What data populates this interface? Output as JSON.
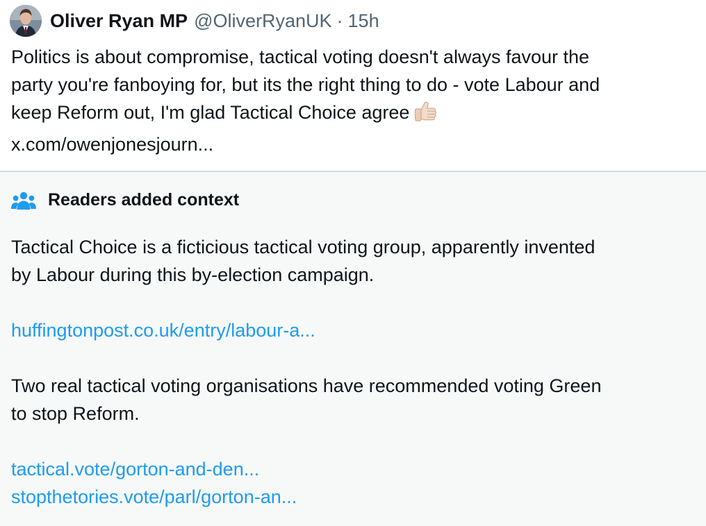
{
  "tweet": {
    "author_name": "Oliver Ryan MP",
    "author_handle": "@OliverRyanUK",
    "separator": "·",
    "timestamp": "15h",
    "body_lines": [
      "Politics is about compromise, tactical voting doesn't always favour the",
      "party you're fanboying for, but its the right thing to do - vote Labour and",
      "keep Reform out, I'm glad Tactical Choice agree",
      "x.com/owenjonesjourn..."
    ],
    "emoji_icon": "thumbs-up-icon"
  },
  "context": {
    "icon": "people-icon",
    "title": "Readers added context",
    "paragraph1_lines": [
      "Tactical Choice is a ficticious tactical voting group, apparently invented",
      "by Labour during this by-election campaign."
    ],
    "link1": "huffingtonpost.co.uk/entry/labour-a...",
    "paragraph2_lines": [
      "Two real tactical voting organisations have recommended voting Green",
      "to stop Reform."
    ],
    "link2": "tactical.vote/gorton-and-den...",
    "link3": "stopthetories.vote/parl/gorton-an..."
  },
  "colors": {
    "text": "#0f1419",
    "secondary_text": "#536471",
    "link": "#1d9bf0",
    "context_background": "#f7f9f9",
    "divider": "#cfd9de"
  }
}
